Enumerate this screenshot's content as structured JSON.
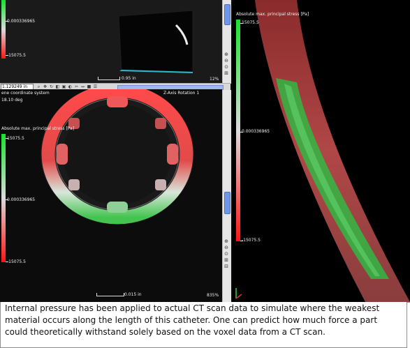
{
  "top_view": {
    "legend_mid": "0.000336965",
    "legend_low": "-15075.5",
    "scale_label": "0.95 in",
    "zoom_percent": "12%"
  },
  "toolbar": {
    "coordinate_value": "1.129249 in",
    "icons": [
      "zoom",
      "pan",
      "rotate",
      "fit",
      "box",
      "render",
      "clip",
      "measure",
      "color",
      "layers"
    ]
  },
  "bottom_view": {
    "coord_system": "ene coordinate system",
    "rotation_value": "18.10 deg",
    "axis_rotation_label": "Z-Axis Rotation 1",
    "legend_title": "Absolute max. principal stress [Pa]",
    "legend_max": "15075.5",
    "legend_mid": "0.000336965",
    "legend_min": "-15075.5",
    "scale_label": "0.015 in",
    "zoom_percent": "835%"
  },
  "right_view": {
    "legend_title": "Absolute max. principal stress [Pa]",
    "legend_max": "15075.5",
    "legend_mid": "0.000336965",
    "legend_min": "-15075.5"
  },
  "caption": {
    "text": "Internal pressure has been applied to actual CT scan data to simulate where the weakest material occurs along the length of this catheter. One can predict how much force a part could theoretically withstand solely based on the voxel data from a CT scan."
  },
  "colors": {
    "high_stress": "#ff1212",
    "neutral_stress": "#dcdcdc",
    "low_stress": "#15e32b",
    "scrollbar_thumb": "#6f96e8"
  }
}
